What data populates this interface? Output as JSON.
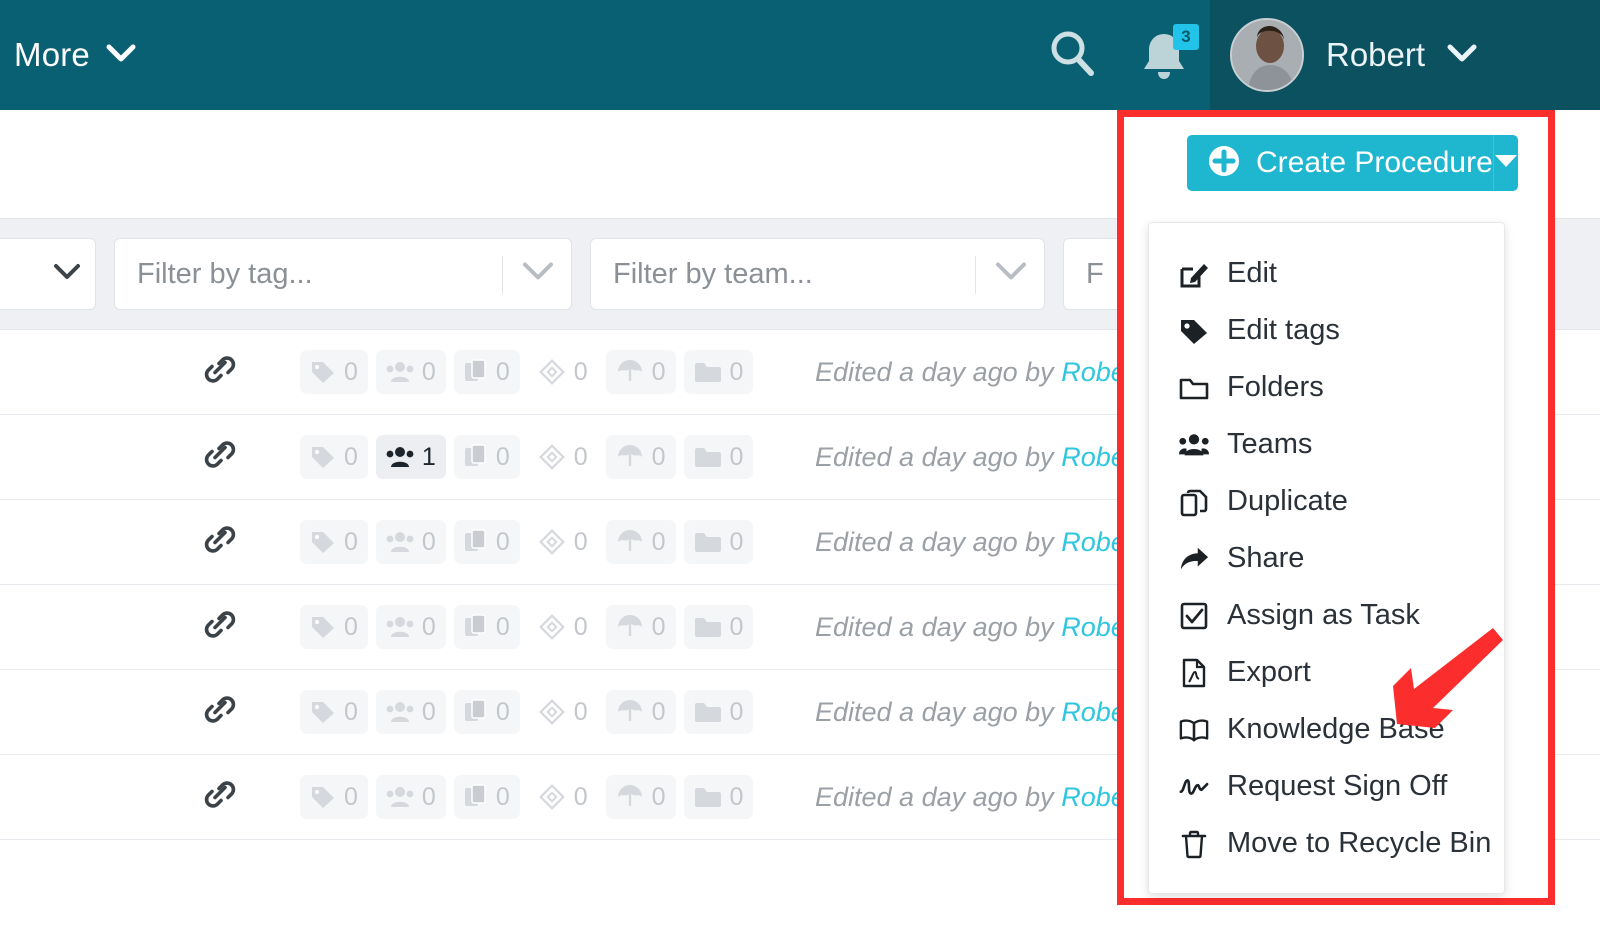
{
  "topbar": {
    "more_label": "More",
    "search_icon": "search-icon",
    "bell_icon": "bell-icon",
    "notification_count": "3",
    "user_name": "Robert",
    "user_caret": "chevron-down-icon",
    "bg_color": "#0a6073",
    "user_bg_color": "#0b5160",
    "badge_color": "#21c3e8"
  },
  "toolbar": {
    "create_label": "Create Procedure",
    "create_plus_icon": "plus-circle-icon",
    "create_caret_icon": "caret-down-icon",
    "create_color": "#1fb6d0"
  },
  "filters": [
    {
      "placeholder": "Filter by tag...",
      "name": "filter-by-tag"
    },
    {
      "placeholder": "Filter by team...",
      "name": "filter-by-team"
    },
    {
      "placeholder": "F",
      "name": "filter-third-truncated"
    }
  ],
  "menu": {
    "items": [
      {
        "label": "Edit",
        "icon": "edit-pencil-square-icon"
      },
      {
        "label": "Edit tags",
        "icon": "tag-icon"
      },
      {
        "label": "Folders",
        "icon": "folder-icon"
      },
      {
        "label": "Teams",
        "icon": "users-icon"
      },
      {
        "label": "Duplicate",
        "icon": "copy-icon"
      },
      {
        "label": "Share",
        "icon": "share-arrow-icon"
      },
      {
        "label": "Assign as Task",
        "icon": "checkbox-icon"
      },
      {
        "label": "Export",
        "icon": "file-pdf-icon"
      },
      {
        "label": "Knowledge Base",
        "icon": "open-book-icon"
      },
      {
        "label": "Request Sign Off",
        "icon": "signature-icon"
      },
      {
        "label": "Move to Recycle Bin",
        "icon": "trash-icon"
      }
    ]
  },
  "annotation": {
    "highlight_color": "#fb2d2d",
    "arrow_color": "#fb2d2d",
    "arrow_target": "Knowledge Base"
  },
  "table": {
    "edited_prefix": "Edited a day ago by",
    "edited_author": "Robert",
    "author_color": "#2fc6e0",
    "badge_icons": [
      "tag-icon",
      "users-icon",
      "copy-icon",
      "diamond-icon",
      "umbrella-icon",
      "folder-icon"
    ],
    "rows": [
      {
        "link_icon": "link-icon",
        "counts": [
          "0",
          "0",
          "0",
          "0",
          "0",
          "0"
        ],
        "active_index": -1
      },
      {
        "link_icon": "link-icon",
        "counts": [
          "0",
          "1",
          "0",
          "0",
          "0",
          "0"
        ],
        "active_index": 1
      },
      {
        "link_icon": "link-icon",
        "counts": [
          "0",
          "0",
          "0",
          "0",
          "0",
          "0"
        ],
        "active_index": -1
      },
      {
        "link_icon": "link-icon",
        "counts": [
          "0",
          "0",
          "0",
          "0",
          "0",
          "0"
        ],
        "active_index": -1
      },
      {
        "link_icon": "link-icon",
        "counts": [
          "0",
          "0",
          "0",
          "0",
          "0",
          "0"
        ],
        "active_index": -1
      },
      {
        "link_icon": "link-icon",
        "counts": [
          "0",
          "0",
          "0",
          "0",
          "0",
          "0"
        ],
        "active_index": -1
      }
    ]
  }
}
